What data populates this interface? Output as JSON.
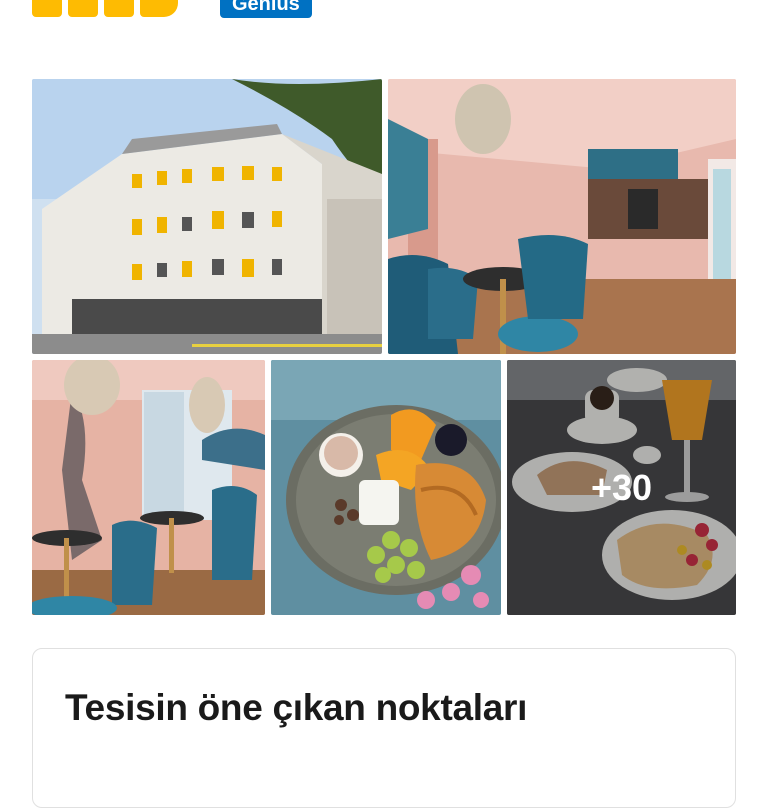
{
  "rating": {
    "squares": 4,
    "icon": "rating-square-icon",
    "color": "#febb02"
  },
  "genius_badge": {
    "label": "Genius",
    "color": "#0071c2"
  },
  "gallery": {
    "photos": [
      {
        "icon": "hotel-building-photo"
      },
      {
        "icon": "lounge-bar-photo"
      },
      {
        "icon": "lounge-seating-photo"
      },
      {
        "icon": "breakfast-plate-photo"
      },
      {
        "icon": "breakfast-table-photo",
        "more_label": "+30"
      }
    ]
  },
  "highlights": {
    "title": "Tesisin öne çıkan noktaları"
  }
}
